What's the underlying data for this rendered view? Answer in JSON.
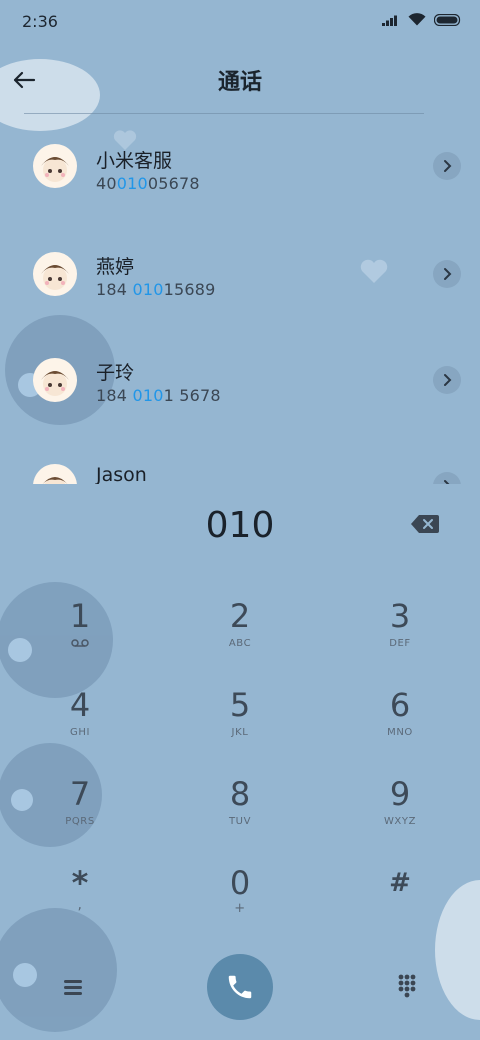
{
  "status_bar": {
    "time": "2:36"
  },
  "header": {
    "title": "通话"
  },
  "contacts": [
    {
      "name": "小米客服",
      "number_pre": "40",
      "number_hl": "010",
      "number_post": "05678"
    },
    {
      "name": "燕婷",
      "number_pre": "184 ",
      "number_hl": "010",
      "number_post": "15689"
    },
    {
      "name": "子玲",
      "number_pre": "184 ",
      "number_hl": "010",
      "number_post": "1 5678"
    },
    {
      "name": "Jason",
      "number_pre": "",
      "number_hl": "",
      "number_post": ""
    }
  ],
  "dialer": {
    "input": "010"
  },
  "keypad": [
    {
      "digit": "1",
      "letters": ""
    },
    {
      "digit": "2",
      "letters": "ABC"
    },
    {
      "digit": "3",
      "letters": "DEF"
    },
    {
      "digit": "4",
      "letters": "GHI"
    },
    {
      "digit": "5",
      "letters": "JKL"
    },
    {
      "digit": "6",
      "letters": "MNO"
    },
    {
      "digit": "7",
      "letters": "PQRS"
    },
    {
      "digit": "8",
      "letters": "TUV"
    },
    {
      "digit": "9",
      "letters": "WXYZ"
    },
    {
      "digit": "*",
      "letters": ","
    },
    {
      "digit": "0",
      "letters": "+"
    },
    {
      "digit": "#",
      "letters": ""
    }
  ],
  "colors": {
    "background": "#95b6d1",
    "accent": "#2196e8",
    "call_button": "#5b8aab"
  },
  "icons": {
    "back": "arrow-left-icon",
    "detail": "chevron-right-icon",
    "delete": "backspace-icon",
    "voicemail": "voicemail-icon",
    "menu": "menu-icon",
    "call": "phone-icon",
    "keypad_toggle": "dialpad-icon"
  }
}
